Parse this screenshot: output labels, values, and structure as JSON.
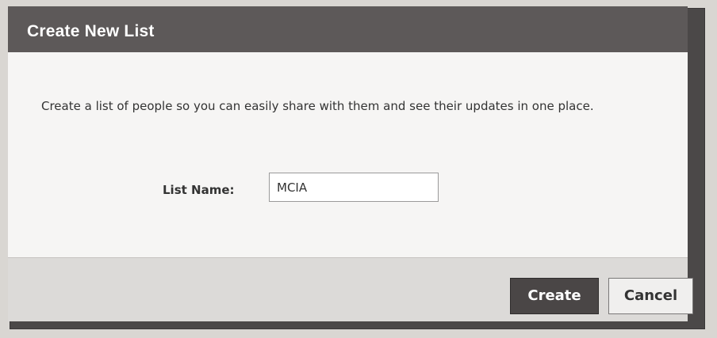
{
  "dialog": {
    "title": "Create New List",
    "description": "Create a list of people so you can easily share with them and see their updates in one place.",
    "field": {
      "label": "List Name:",
      "value": "MCIA"
    },
    "buttons": {
      "create": "Create",
      "cancel": "Cancel"
    }
  }
}
